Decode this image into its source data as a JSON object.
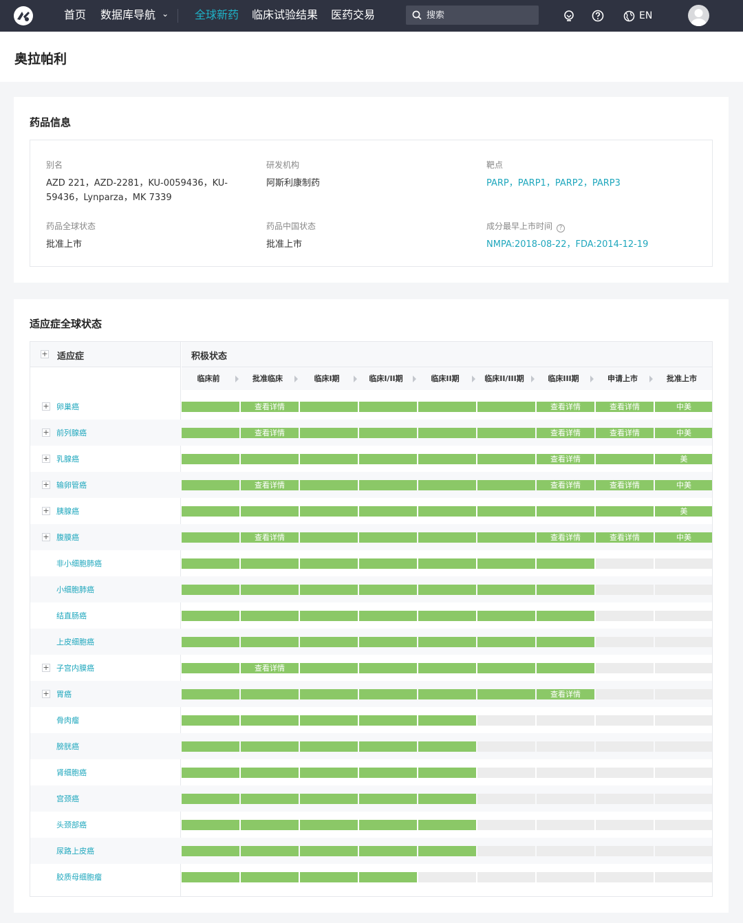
{
  "nav": {
    "items": [
      {
        "label": "首页",
        "active": false
      },
      {
        "label": "数据库导航",
        "active": false,
        "dropdown": true
      },
      {
        "label": "全球新药",
        "active": true
      },
      {
        "label": "临床试验结果",
        "active": false
      },
      {
        "label": "医药交易",
        "active": false
      }
    ],
    "search_placeholder": "搜索",
    "lang": "EN",
    "dropdown_glyph": "⌄",
    "colors": {
      "bg": "#2f3341",
      "accent": "#1fb2c7"
    }
  },
  "page_title": "奥拉帕利",
  "drug_info": {
    "title": "药品信息",
    "fields": {
      "alias": {
        "label": "别名",
        "value": "AZD 221，AZD-2281，KU-0059436，KU-59436，Lynparza，MK 7339"
      },
      "org": {
        "label": "研发机构",
        "value": "阿斯利康制药"
      },
      "target": {
        "label": "靶点",
        "value": "PARP，PARP1，PARP2，PARP3"
      },
      "global_status": {
        "label": "药品全球状态",
        "value": "批准上市"
      },
      "china_status": {
        "label": "药品中国状态",
        "value": "批准上市"
      },
      "first_launch": {
        "label": "成分最早上市时间",
        "value": "NMPA:2018-08-22，FDA:2014-12-19"
      }
    },
    "help_glyph": "?"
  },
  "indications": {
    "title": "适应症全球状态",
    "col_indication": "适应症",
    "col_status": "积极状态",
    "plus_glyph": "+",
    "stages": [
      "临床前",
      "批准临床",
      "临床I期",
      "临床I/II期",
      "临床II期",
      "临床II/III期",
      "临床III期",
      "申请上市",
      "批准上市"
    ],
    "colors": {
      "active": "#8bc867",
      "inactive": "#ececec",
      "link": "#1fa7bd"
    },
    "rows": [
      {
        "name": "卵巢癌",
        "expandable": true,
        "reached": 9,
        "labels": [
          "",
          "查看详情",
          "",
          "",
          "",
          "",
          "查看详情",
          "查看详情",
          "中美"
        ]
      },
      {
        "name": "前列腺癌",
        "expandable": true,
        "reached": 9,
        "labels": [
          "",
          "查看详情",
          "",
          "",
          "",
          "",
          "查看详情",
          "查看详情",
          "中美"
        ]
      },
      {
        "name": "乳腺癌",
        "expandable": true,
        "reached": 9,
        "labels": [
          "",
          "",
          "",
          "",
          "",
          "",
          "查看详情",
          "",
          "美"
        ]
      },
      {
        "name": "输卵管癌",
        "expandable": true,
        "reached": 9,
        "labels": [
          "",
          "查看详情",
          "",
          "",
          "",
          "",
          "查看详情",
          "查看详情",
          "中美"
        ]
      },
      {
        "name": "胰腺癌",
        "expandable": true,
        "reached": 9,
        "labels": [
          "",
          "",
          "",
          "",
          "",
          "",
          "",
          "",
          "美"
        ]
      },
      {
        "name": "腹膜癌",
        "expandable": true,
        "reached": 9,
        "labels": [
          "",
          "查看详情",
          "",
          "",
          "",
          "",
          "查看详情",
          "查看详情",
          "中美"
        ]
      },
      {
        "name": "非小细胞肺癌",
        "expandable": false,
        "reached": 7,
        "labels": [
          "",
          "",
          "",
          "",
          "",
          "",
          "",
          "",
          ""
        ]
      },
      {
        "name": "小细胞肺癌",
        "expandable": false,
        "reached": 7,
        "labels": [
          "",
          "",
          "",
          "",
          "",
          "",
          "",
          "",
          ""
        ]
      },
      {
        "name": "结直肠癌",
        "expandable": false,
        "reached": 7,
        "labels": [
          "",
          "",
          "",
          "",
          "",
          "",
          "",
          "",
          ""
        ]
      },
      {
        "name": "上皮细胞癌",
        "expandable": false,
        "reached": 7,
        "labels": [
          "",
          "",
          "",
          "",
          "",
          "",
          "",
          "",
          ""
        ]
      },
      {
        "name": "子宫内膜癌",
        "expandable": true,
        "reached": 7,
        "labels": [
          "",
          "查看详情",
          "",
          "",
          "",
          "",
          "",
          "",
          ""
        ]
      },
      {
        "name": "胃癌",
        "expandable": true,
        "reached": 7,
        "labels": [
          "",
          "",
          "",
          "",
          "",
          "",
          "查看详情",
          "",
          ""
        ]
      },
      {
        "name": "骨肉瘤",
        "expandable": false,
        "reached": 5,
        "labels": [
          "",
          "",
          "",
          "",
          "",
          "",
          "",
          "",
          ""
        ]
      },
      {
        "name": "膀胱癌",
        "expandable": false,
        "reached": 5,
        "labels": [
          "",
          "",
          "",
          "",
          "",
          "",
          "",
          "",
          ""
        ]
      },
      {
        "name": "肾细胞癌",
        "expandable": false,
        "reached": 5,
        "labels": [
          "",
          "",
          "",
          "",
          "",
          "",
          "",
          "",
          ""
        ]
      },
      {
        "name": "宫颈癌",
        "expandable": false,
        "reached": 5,
        "labels": [
          "",
          "",
          "",
          "",
          "",
          "",
          "",
          "",
          ""
        ]
      },
      {
        "name": "头颈部癌",
        "expandable": false,
        "reached": 5,
        "labels": [
          "",
          "",
          "",
          "",
          "",
          "",
          "",
          "",
          ""
        ]
      },
      {
        "name": "尿路上皮癌",
        "expandable": false,
        "reached": 5,
        "labels": [
          "",
          "",
          "",
          "",
          "",
          "",
          "",
          "",
          ""
        ]
      },
      {
        "name": "胶质母细胞瘤",
        "expandable": false,
        "reached": 4,
        "labels": [
          "",
          "",
          "",
          "",
          "",
          "",
          "",
          "",
          ""
        ]
      }
    ]
  }
}
